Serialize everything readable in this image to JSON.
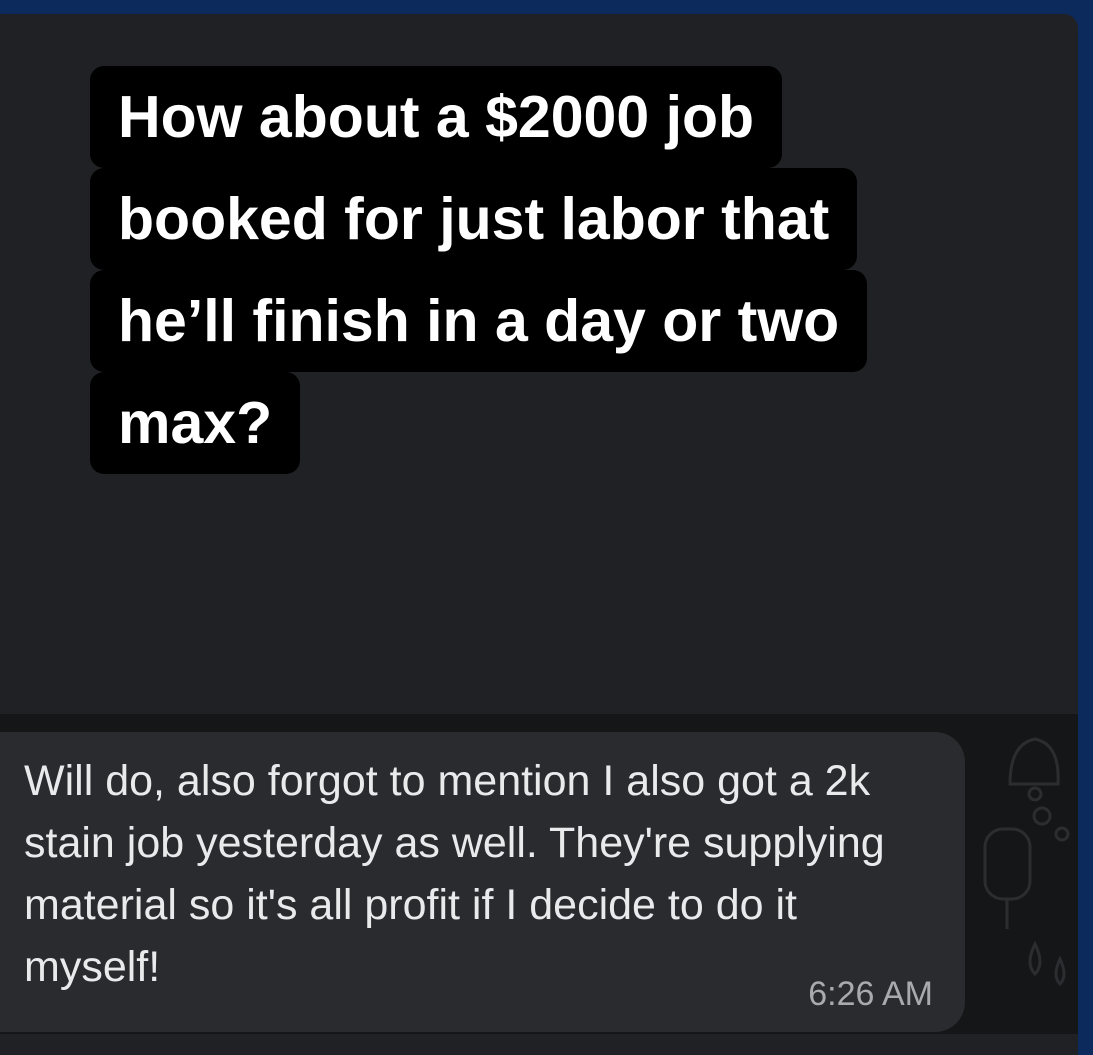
{
  "caption": {
    "lines": [
      "How about a $2000 job",
      "booked for just labor that",
      "he’ll finish in a day or two",
      "max?"
    ]
  },
  "message": {
    "text": "Will do, also forgot to mention I also got a 2k stain job yesterday as well. They're supplying material so it's all profit if I decide to do it myself!",
    "time": "6:26 AM"
  },
  "colors": {
    "outer_border": "#0d2a5c",
    "chat_background": "#202124",
    "caption_background": "#000000",
    "bubble": "#2a2b2e"
  }
}
